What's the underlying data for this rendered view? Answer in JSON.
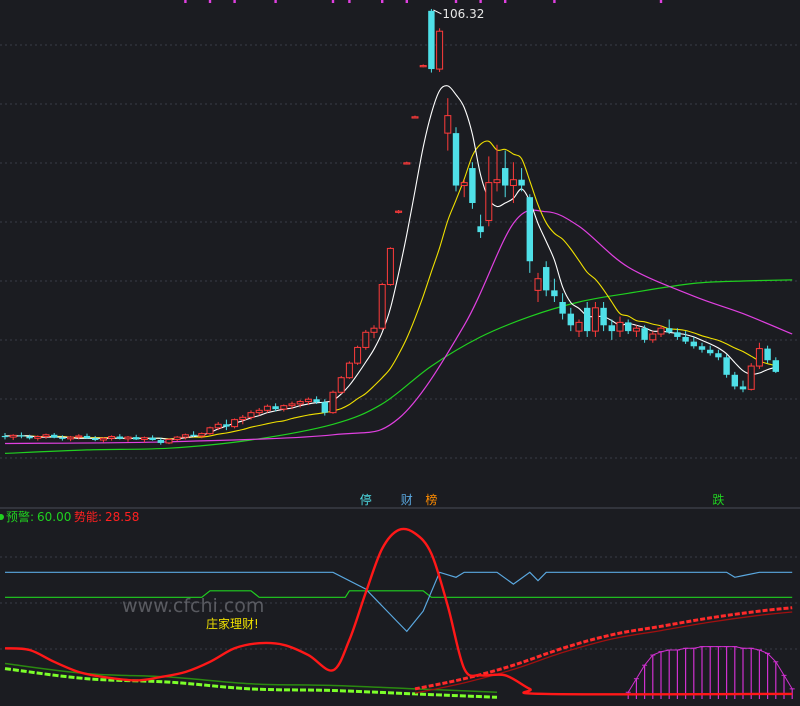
{
  "colors": {
    "background": "#1b1c21",
    "grid": "#3a3c48",
    "up_candle": "#ff3b3b",
    "down_candle": "#4fe0e8",
    "ma5": "#ffffff",
    "ma10": "#f0e000",
    "ma20": "#e040e0",
    "ma60": "#20d020",
    "warning_line": "#5aa8e0",
    "momentum_line": "#ff1818",
    "green_ladder": "#7cff2a",
    "magenta_fill": "#d030d0"
  },
  "chart_data": [
    {
      "type": "candlestick",
      "max_price_label": "106.32",
      "ylim": [
        22,
        107
      ],
      "candles": [
        [
          33.0,
          33.5,
          32.4,
          32.8
        ],
        [
          32.8,
          33.3,
          32.3,
          33.1
        ],
        [
          33.1,
          33.6,
          32.6,
          32.9
        ],
        [
          32.9,
          33.2,
          32.4,
          32.6
        ],
        [
          32.6,
          33.1,
          32.2,
          32.9
        ],
        [
          32.9,
          33.4,
          32.5,
          33.2
        ],
        [
          33.2,
          33.5,
          32.6,
          32.7
        ],
        [
          32.7,
          33.1,
          32.2,
          32.5
        ],
        [
          32.5,
          33.0,
          32.1,
          32.8
        ],
        [
          32.8,
          33.3,
          32.4,
          33.0
        ],
        [
          33.0,
          33.4,
          32.5,
          32.6
        ],
        [
          32.6,
          33.0,
          32.1,
          32.3
        ],
        [
          32.3,
          32.8,
          31.9,
          32.6
        ],
        [
          32.6,
          33.1,
          32.2,
          32.9
        ],
        [
          32.9,
          33.3,
          32.4,
          32.5
        ],
        [
          32.5,
          33.0,
          32.0,
          32.8
        ],
        [
          32.8,
          33.2,
          32.3,
          32.4
        ],
        [
          32.4,
          32.9,
          31.9,
          32.7
        ],
        [
          32.7,
          33.1,
          32.2,
          32.3
        ],
        [
          32.3,
          32.7,
          31.5,
          31.8
        ],
        [
          31.8,
          32.6,
          31.6,
          32.4
        ],
        [
          32.4,
          33.0,
          32.1,
          32.8
        ],
        [
          32.8,
          33.4,
          32.4,
          33.2
        ],
        [
          33.2,
          33.8,
          32.8,
          33.0
        ],
        [
          33.0,
          33.6,
          32.6,
          33.4
        ],
        [
          33.4,
          34.6,
          33.2,
          34.4
        ],
        [
          34.4,
          35.4,
          34.0,
          35.0
        ],
        [
          35.0,
          35.8,
          34.0,
          34.6
        ],
        [
          34.6,
          36.0,
          34.3,
          35.8
        ],
        [
          35.8,
          36.6,
          35.0,
          36.2
        ],
        [
          36.2,
          37.4,
          35.8,
          37.0
        ],
        [
          37.0,
          37.8,
          36.5,
          37.4
        ],
        [
          37.4,
          38.4,
          37.0,
          38.1
        ],
        [
          38.1,
          38.6,
          37.2,
          37.6
        ],
        [
          37.6,
          38.4,
          37.2,
          38.2
        ],
        [
          38.2,
          38.9,
          37.6,
          38.5
        ],
        [
          38.5,
          39.2,
          37.9,
          38.9
        ],
        [
          38.9,
          39.6,
          38.3,
          39.3
        ],
        [
          39.3,
          39.8,
          38.5,
          38.8
        ],
        [
          38.8,
          39.3,
          36.5,
          37.0
        ],
        [
          37.0,
          40.8,
          36.8,
          40.5
        ],
        [
          40.5,
          43.3,
          40.2,
          43.0
        ],
        [
          43.0,
          45.8,
          42.8,
          45.5
        ],
        [
          45.5,
          48.5,
          45.2,
          48.2
        ],
        [
          48.2,
          51.2,
          47.8,
          50.8
        ],
        [
          50.8,
          52.0,
          49.8,
          51.5
        ],
        [
          51.5,
          59.3,
          51.2,
          59.0
        ],
        [
          59.0,
          65.4,
          58.8,
          65.2
        ],
        [
          71.5,
          71.8,
          71.2,
          71.6
        ],
        [
          79.8,
          80.1,
          79.6,
          79.9
        ],
        [
          87.7,
          88.0,
          87.5,
          87.8
        ],
        [
          96.5,
          96.8,
          96.3,
          96.6
        ],
        [
          106.0,
          106.32,
          95.4,
          96.0
        ],
        [
          96.0,
          103.0,
          95.5,
          102.5
        ],
        [
          85.0,
          91.0,
          82.0,
          88.0
        ],
        [
          85.0,
          86.0,
          75.0,
          76.0
        ],
        [
          76.0,
          77.0,
          74.0,
          76.5
        ],
        [
          79.0,
          80.0,
          72.0,
          73.0
        ],
        [
          69.0,
          71.0,
          67.0,
          68.0
        ],
        [
          70.0,
          81.0,
          69.0,
          76.5
        ],
        [
          76.5,
          83.0,
          75.0,
          77.0
        ],
        [
          79.0,
          82.0,
          74.0,
          76.0
        ],
        [
          76.0,
          80.0,
          73.0,
          77.0
        ],
        [
          77.0,
          79.0,
          75.0,
          76.0
        ],
        [
          74.0,
          74.5,
          61.0,
          63.0
        ],
        [
          58.0,
          61.0,
          56.0,
          60.0
        ],
        [
          62.0,
          63.0,
          57.0,
          58.0
        ],
        [
          58.0,
          60.0,
          56.0,
          57.0
        ],
        [
          56.0,
          57.5,
          53.0,
          54.0
        ],
        [
          54.0,
          55.0,
          51.0,
          52.0
        ],
        [
          51.0,
          53.0,
          50.0,
          52.5
        ],
        [
          55.0,
          56.0,
          50.0,
          51.0
        ],
        [
          51.0,
          56.0,
          50.0,
          55.0
        ],
        [
          55.0,
          56.0,
          51.0,
          52.0
        ],
        [
          52.0,
          53.0,
          49.5,
          51.0
        ],
        [
          51.0,
          53.5,
          50.0,
          52.5
        ],
        [
          52.5,
          53.0,
          50.5,
          51.0
        ],
        [
          51.0,
          52.0,
          50.0,
          51.5
        ],
        [
          51.5,
          52.0,
          49.0,
          49.5
        ],
        [
          49.5,
          51.0,
          49.0,
          50.5
        ],
        [
          50.5,
          52.0,
          50.0,
          51.5
        ],
        [
          51.5,
          53.0,
          50.5,
          50.8
        ],
        [
          50.8,
          51.5,
          49.5,
          50.0
        ],
        [
          50.0,
          51.0,
          48.8,
          49.2
        ],
        [
          49.2,
          50.0,
          48.0,
          48.4
        ],
        [
          48.4,
          49.0,
          47.3,
          47.8
        ],
        [
          47.8,
          48.5,
          46.8,
          47.2
        ],
        [
          47.2,
          47.8,
          46.0,
          46.5
        ],
        [
          46.5,
          47.0,
          43.0,
          43.5
        ],
        [
          43.5,
          44.0,
          41.0,
          41.5
        ],
        [
          41.5,
          42.5,
          40.5,
          41.0
        ],
        [
          41.0,
          45.5,
          40.8,
          45.0
        ],
        [
          45.0,
          49.0,
          44.5,
          48.0
        ],
        [
          48.0,
          48.5,
          45.5,
          46.0
        ],
        [
          46.0,
          46.5,
          43.8,
          44.0
        ]
      ],
      "ma_lines": {
        "ma5": [
          33,
          33,
          33,
          33,
          32.8,
          32.8,
          32.8,
          32.8,
          32.7,
          32.6,
          32.6,
          32.6,
          32.6,
          32.6,
          32.6,
          32.6,
          32.6,
          32.6,
          32.6,
          32.6,
          32.4,
          32.5,
          32.7,
          32.9,
          33.1,
          33.6,
          34.2,
          34.7,
          35.2,
          35.6,
          36.1,
          36.5,
          37,
          37.3,
          37.6,
          37.8,
          38.2,
          38.5,
          38.7,
          38.8,
          39.1,
          40.2,
          41.7,
          43.6,
          45.7,
          47.9,
          50.8,
          54.9,
          60.9,
          67.6,
          75.1,
          82.6,
          88.4,
          92.3,
          93.1,
          91.6,
          89.4,
          84.8,
          77.8,
          73.7,
          72.4,
          73,
          73.8,
          75.4,
          73.3,
          69.5,
          66.4,
          63.2,
          58.6,
          55.9,
          54.9,
          53.6,
          53.5,
          53.5,
          52.8,
          52,
          52.3,
          52,
          51.6,
          51,
          51,
          50.8,
          50.6,
          50.4,
          50,
          49.4,
          48.8,
          48.1,
          47.1,
          45.6,
          44.2,
          43.6,
          43.8,
          44.4,
          44.8
        ],
        "ma10": [
          33,
          33,
          33,
          33,
          32.9,
          32.9,
          32.9,
          32.9,
          32.8,
          32.7,
          32.7,
          32.7,
          32.7,
          32.7,
          32.6,
          32.6,
          32.6,
          32.6,
          32.6,
          32.6,
          32.5,
          32.6,
          32.7,
          32.8,
          32.8,
          33,
          33.3,
          33.5,
          33.8,
          34.1,
          34.5,
          34.8,
          35.1,
          35.4,
          35.6,
          36,
          36.3,
          36.6,
          36.8,
          37,
          37.3,
          37.7,
          38.4,
          39.4,
          40.3,
          41.6,
          43,
          44.6,
          47,
          49.8,
          53.2,
          57,
          61.2,
          65.3,
          70,
          73.5,
          77.1,
          81.1,
          83.1,
          83.6,
          82.1,
          82.2,
          81.4,
          80.6,
          76.8,
          72.7,
          69.6,
          67.8,
          66.8,
          65.1,
          63.1,
          61.1,
          59.9,
          58.1,
          56,
          54,
          53.6,
          52.8,
          52.6,
          52.2,
          51.9,
          51.4,
          51.3,
          51.1,
          50.7,
          50.2,
          49.8,
          49.4,
          48.8,
          48.1,
          47.5,
          46.7,
          45.9,
          45.4,
          45.1
        ]
      },
      "ma_curves": {
        "ma20": [
          [
            0,
            31.7
          ],
          [
            20,
            32.0
          ],
          [
            40,
            33.2
          ],
          [
            48,
            36.0
          ],
          [
            56,
            52.0
          ],
          [
            62,
            69.5
          ],
          [
            66,
            71.5
          ],
          [
            70,
            69.0
          ],
          [
            76,
            62.0
          ],
          [
            84,
            57.0
          ],
          [
            90,
            54.0
          ],
          [
            96,
            50.5
          ]
        ],
        "ma60": [
          [
            0,
            30.0
          ],
          [
            10,
            30.6
          ],
          [
            20,
            30.9
          ],
          [
            30,
            32.3
          ],
          [
            40,
            35.0
          ],
          [
            46,
            38.5
          ],
          [
            52,
            45.0
          ],
          [
            58,
            50.0
          ],
          [
            64,
            53.5
          ],
          [
            70,
            56.0
          ],
          [
            76,
            57.5
          ],
          [
            84,
            59.2
          ],
          [
            90,
            59.6
          ],
          [
            96,
            59.8
          ]
        ]
      },
      "signal_labels": [
        {
          "text": "停",
          "color": "#4fe0e8"
        },
        {
          "text": "财",
          "color": "#5aa8e0"
        },
        {
          "text": "榜",
          "color": "#ff8c00"
        },
        {
          "text": "跌",
          "color": "#20d020"
        }
      ]
    },
    {
      "type": "line",
      "ylim": [
        0,
        100
      ],
      "series": [
        {
          "name": "预警",
          "current_value": "60.00",
          "color": "#20d020"
        },
        {
          "name": "势能",
          "current_value": "28.58",
          "color": "#ff1818"
        }
      ],
      "zhuangjia_label": "庄家理财!",
      "warning_step": [
        [
          0,
          60.2
        ],
        [
          24,
          60.2
        ],
        [
          25,
          64
        ],
        [
          30,
          64
        ],
        [
          31,
          60.2
        ],
        [
          41,
          60.2
        ],
        [
          41.5,
          60.2
        ],
        [
          42,
          64
        ],
        [
          51,
          64
        ],
        [
          52,
          60.2
        ],
        [
          96,
          60.2
        ]
      ],
      "blue_line": [
        [
          0,
          75
        ],
        [
          40,
          75
        ],
        [
          44,
          65
        ],
        [
          48,
          45
        ],
        [
          49,
          40
        ],
        [
          51,
          52
        ],
        [
          53,
          75
        ],
        [
          55,
          72
        ],
        [
          56,
          75
        ],
        [
          60,
          75
        ],
        [
          62,
          68
        ],
        [
          64,
          75
        ],
        [
          65,
          70
        ],
        [
          66,
          75
        ],
        [
          72,
          75
        ],
        [
          74,
          75
        ],
        [
          75,
          75
        ],
        [
          88,
          75
        ],
        [
          89,
          72
        ],
        [
          90,
          73
        ],
        [
          92,
          75
        ],
        [
          96,
          75
        ]
      ],
      "momentum": [
        [
          0,
          30
        ],
        [
          3,
          29
        ],
        [
          6,
          22
        ],
        [
          9,
          16
        ],
        [
          12,
          13
        ],
        [
          16,
          11
        ],
        [
          19,
          13
        ],
        [
          22,
          16
        ],
        [
          25,
          22
        ],
        [
          28,
          30
        ],
        [
          31,
          33
        ],
        [
          34,
          32
        ],
        [
          37,
          26
        ],
        [
          40,
          17
        ],
        [
          42,
          35
        ],
        [
          44,
          63
        ],
        [
          46,
          89
        ],
        [
          48,
          100
        ],
        [
          50,
          98
        ],
        [
          52,
          86
        ],
        [
          54,
          55
        ],
        [
          56,
          18
        ],
        [
          58,
          14
        ],
        [
          61,
          14
        ],
        [
          64,
          6
        ],
        [
          66,
          3
        ],
        [
          96,
          3
        ]
      ],
      "magenta_bars": [
        [
          76,
          4
        ],
        [
          77,
          12
        ],
        [
          78,
          20
        ],
        [
          79,
          26
        ],
        [
          80,
          28
        ],
        [
          81,
          29
        ],
        [
          82,
          29
        ],
        [
          83,
          30
        ],
        [
          84,
          30
        ],
        [
          85,
          31
        ],
        [
          86,
          31
        ],
        [
          87,
          31
        ],
        [
          88,
          31
        ],
        [
          89,
          31
        ],
        [
          90,
          30
        ],
        [
          91,
          30
        ],
        [
          92,
          29
        ],
        [
          93,
          27
        ],
        [
          94,
          22
        ],
        [
          95,
          14
        ],
        [
          96,
          6
        ]
      ],
      "green_ladder": [
        [
          0,
          18
        ],
        [
          10,
          12
        ],
        [
          20,
          10
        ],
        [
          30,
          6
        ],
        [
          40,
          5
        ],
        [
          50,
          3
        ],
        [
          55,
          2
        ],
        [
          60,
          1
        ]
      ],
      "red_ladder": [
        [
          50,
          6
        ],
        [
          56,
          12
        ],
        [
          62,
          20
        ],
        [
          68,
          30
        ],
        [
          74,
          38
        ],
        [
          80,
          43
        ],
        [
          86,
          48
        ],
        [
          92,
          52
        ],
        [
          96,
          54
        ]
      ],
      "watermark": "www.cfchi.com"
    }
  ]
}
